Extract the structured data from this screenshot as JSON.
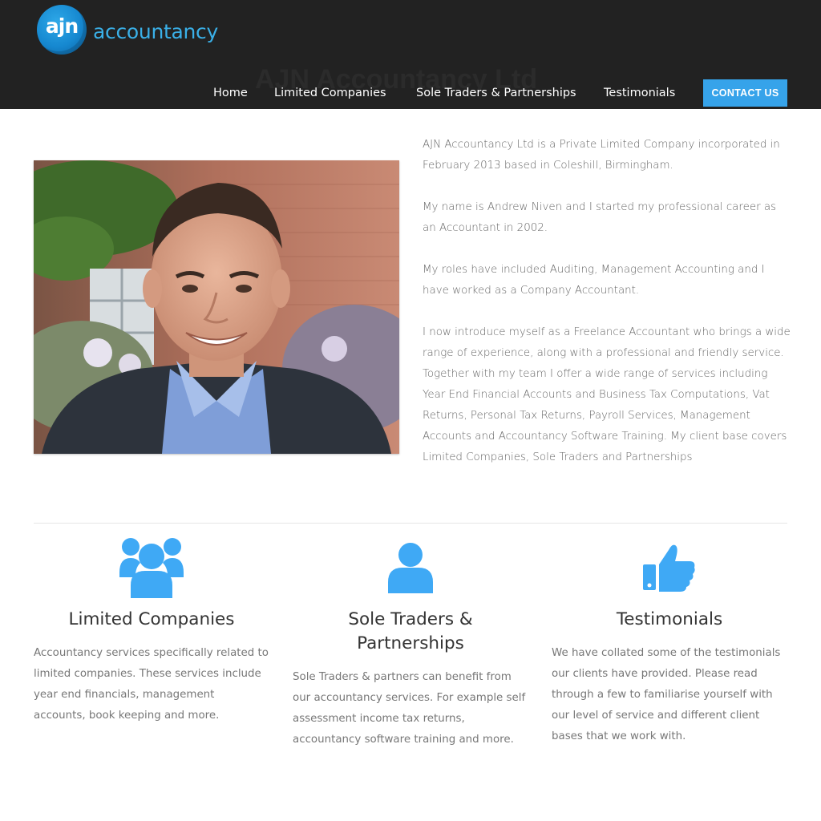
{
  "brand": {
    "badge_text": "ajn",
    "word": "accountancy",
    "accent_color": "#3ab0e8",
    "badge_color": "#1688d0"
  },
  "page_title": "AJN Accountancy Ltd",
  "nav": {
    "items": [
      {
        "label": "Home"
      },
      {
        "label": "Limited Companies"
      },
      {
        "label": "Sole Traders & Partnerships"
      },
      {
        "label": "Testimonials"
      }
    ],
    "contact_label": "CONTACT US",
    "contact_color": "#36a3ea"
  },
  "about": {
    "paragraphs": [
      "AJN Accountancy Ltd is a Private Limited Company incorporated in February 2013 based in Coleshill, Birmingham.",
      "My name is Andrew Niven and I started my professional career as an Accountant in 2002.",
      "My roles have included Auditing, Management Accounting and I have worked as a Company Accountant.",
      "I now introduce myself as a Freelance Accountant who brings a wide range of experience, along with a professional and friendly service. Together with my team I offer a wide range of services including Year End Financial Accounts and Business Tax Computations, Vat Returns, Personal Tax Returns, Payroll Services, Management Accounts and Accountancy Software Training. My client base covers Limited Companies, Sole Traders and Partnerships"
    ]
  },
  "features": [
    {
      "icon": "users-group-icon",
      "title": "Limited Companies",
      "text": "Accountancy services specifically related to limited companies. These services include year end financials, management accounts, book keeping and more."
    },
    {
      "icon": "user-icon",
      "title": "Sole Traders & Partnerships",
      "text": "Sole Traders & partners can benefit from our accountancy services. For example self assessment income tax returns, accountancy software training and more."
    },
    {
      "icon": "thumbs-up-icon",
      "title": "Testimonials",
      "text": "We have collated some of the testimonials our clients have provided. Please read through a few to familiarise yourself with our level of service and different client bases that we work with."
    }
  ],
  "icon_color": "#3fa9f5"
}
